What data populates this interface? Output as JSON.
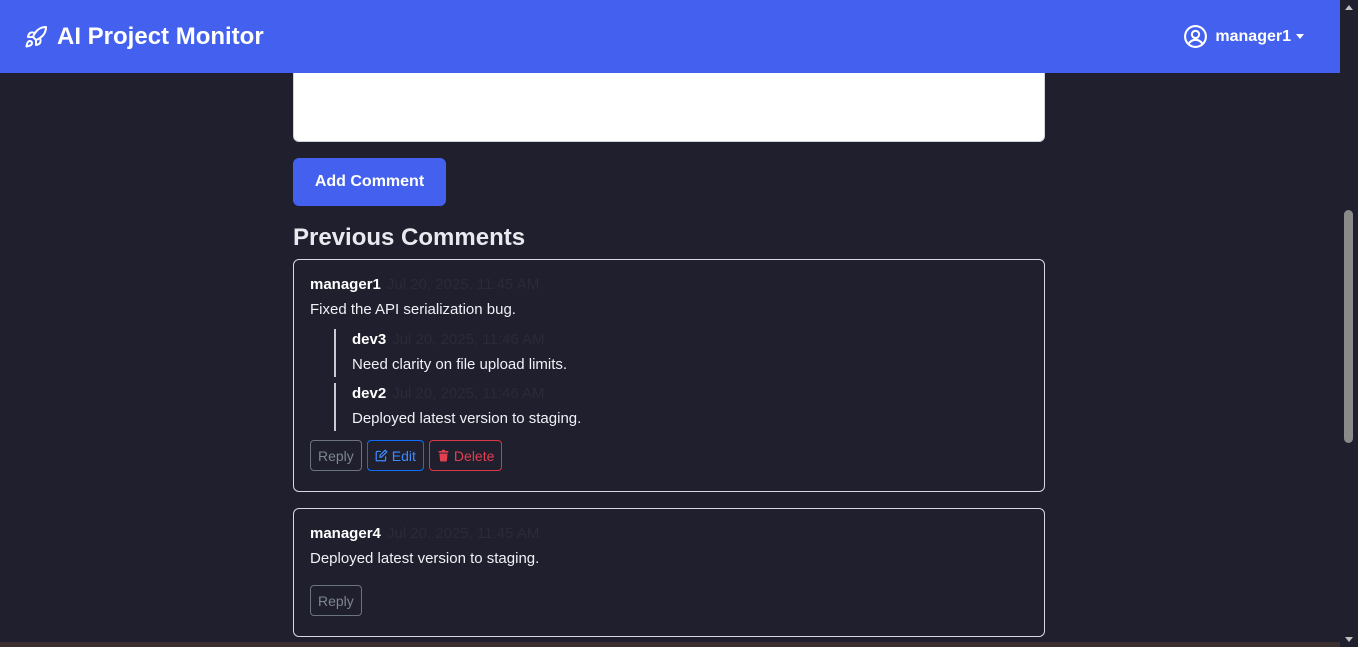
{
  "app": {
    "title": "AI Project Monitor",
    "brand_icon": "rocket-icon",
    "user": "manager1",
    "user_icon": "user-circle-icon"
  },
  "form": {
    "textarea_value": "",
    "add_label": "Add Comment"
  },
  "comments": {
    "section_title": "Previous Comments",
    "items": [
      {
        "author": "manager1",
        "time": "Jul 20, 2025, 11:45 AM",
        "text": "Fixed the API serialization bug.",
        "replies": [
          {
            "author": "dev3",
            "time": "Jul 20, 2025, 11:46 AM",
            "text": "Need clarity on file upload limits."
          },
          {
            "author": "dev2",
            "time": "Jul 20, 2025, 11:46 AM",
            "text": "Deployed latest version to staging."
          }
        ],
        "actions": {
          "reply": "Reply",
          "edit": "Edit",
          "delete": "Delete"
        }
      },
      {
        "author": "manager4",
        "time": "Jul 20, 2025, 11:45 AM",
        "text": "Deployed latest version to staging.",
        "actions": {
          "reply": "Reply"
        }
      }
    ]
  },
  "colors": {
    "accent": "#4361ee",
    "background": "#1f1f2e",
    "edit": "#0d6efd",
    "delete": "#dc3545"
  }
}
